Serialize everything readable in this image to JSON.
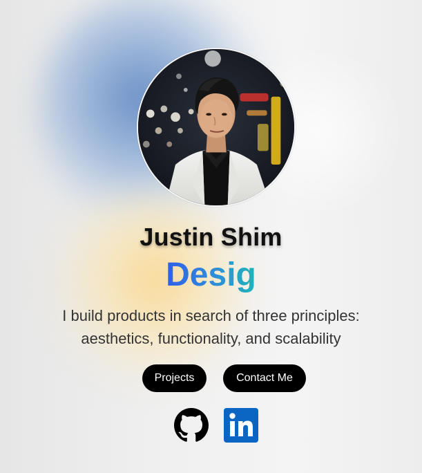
{
  "profile": {
    "name": "Justin Shim",
    "role_text": "Desig",
    "tagline_line1": "I build products in search of three principles:",
    "tagline_line2": "aesthetics, functionality, and scalability"
  },
  "buttons": {
    "projects_label": "Projects",
    "contact_label": "Contact Me"
  },
  "social": [
    {
      "icon": "github-icon"
    },
    {
      "icon": "linkedin-icon",
      "color": "#0a66c2"
    }
  ],
  "colors": {
    "role_gradient_start": "#2f5fe8",
    "role_gradient_end": "#1fb4b8",
    "button_bg": "#000000",
    "linkedin_blue": "#0a66c2"
  }
}
